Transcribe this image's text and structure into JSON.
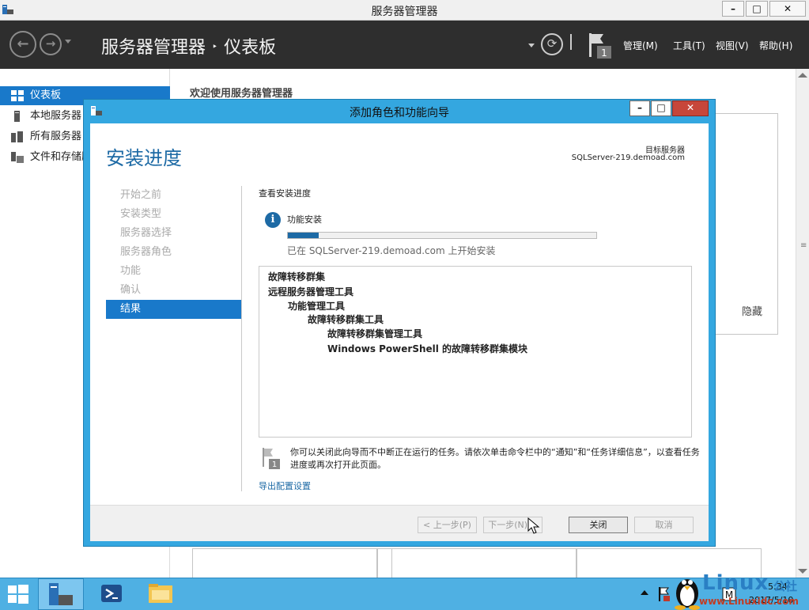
{
  "window": {
    "title": "服务器管理器",
    "btn_min": "–",
    "btn_max": "□",
    "btn_close": "✕"
  },
  "header": {
    "breadcrumb_app": "服务器管理器",
    "breadcrumb_sep": "‣",
    "breadcrumb_page": "仪表板",
    "flag_count": "1",
    "menus": [
      "管理(M)",
      "工具(T)",
      "视图(V)",
      "帮助(H)"
    ]
  },
  "sidebar": {
    "items": [
      {
        "label": "仪表板",
        "icon": "dashboard-icon"
      },
      {
        "label": "本地服务器",
        "icon": "local-server-icon"
      },
      {
        "label": "所有服务器",
        "icon": "all-servers-icon"
      },
      {
        "label": "文件和存储服务",
        "icon": "file-storage-icon"
      }
    ]
  },
  "content": {
    "welcome": "欢迎使用服务器管理器",
    "hide": "隐藏"
  },
  "wizard": {
    "title": "添加角色和功能向导",
    "heading": "安装进度",
    "dest_label": "目标服务器",
    "dest_server": "SQLServer-219.demoad.com",
    "nav": [
      "开始之前",
      "安装类型",
      "服务器选择",
      "服务器角色",
      "功能",
      "确认",
      "结果"
    ],
    "active_step": 6,
    "progress_title": "查看安装进度",
    "feature_install": "功能安装",
    "progress_fraction": 0.1,
    "progress_status": "已在 SQLServer-219.demoad.com 上开始安装",
    "results": [
      {
        "text": "故障转移群集",
        "level": 0
      },
      {
        "text": "远程服务器管理工具",
        "level": 0
      },
      {
        "text": "功能管理工具",
        "level": 1
      },
      {
        "text": "故障转移群集工具",
        "level": 2
      },
      {
        "text": "故障转移群集管理工具",
        "level": 3
      },
      {
        "text": "Windows PowerShell 的故障转移群集模块",
        "level": 3
      }
    ],
    "note_flag_count": "1",
    "note": "你可以关闭此向导而不中断正在运行的任务。请依次单击命令栏中的“通知”和“任务详细信息”，以查看任务进度或再次打开此页面。",
    "export_link": "导出配置设置",
    "buttons": {
      "prev": "< 上一步(P)",
      "next": "下一步(N) >",
      "close": "关闭",
      "cancel": "取消"
    }
  },
  "taskbar": {
    "time": "5:34",
    "date": "2017/5/10",
    "tray_flag_count": "1"
  },
  "watermark": {
    "linux": "Linux",
    "gongshe": "公社",
    "url": "www.Linuxidc.com"
  },
  "colors": {
    "accent": "#1979ca",
    "dialog_frame": "#34a7e0",
    "header_bg": "#2e2e2e",
    "heading_blue": "#1d6aa5",
    "taskbar": "#4fb0e3"
  }
}
